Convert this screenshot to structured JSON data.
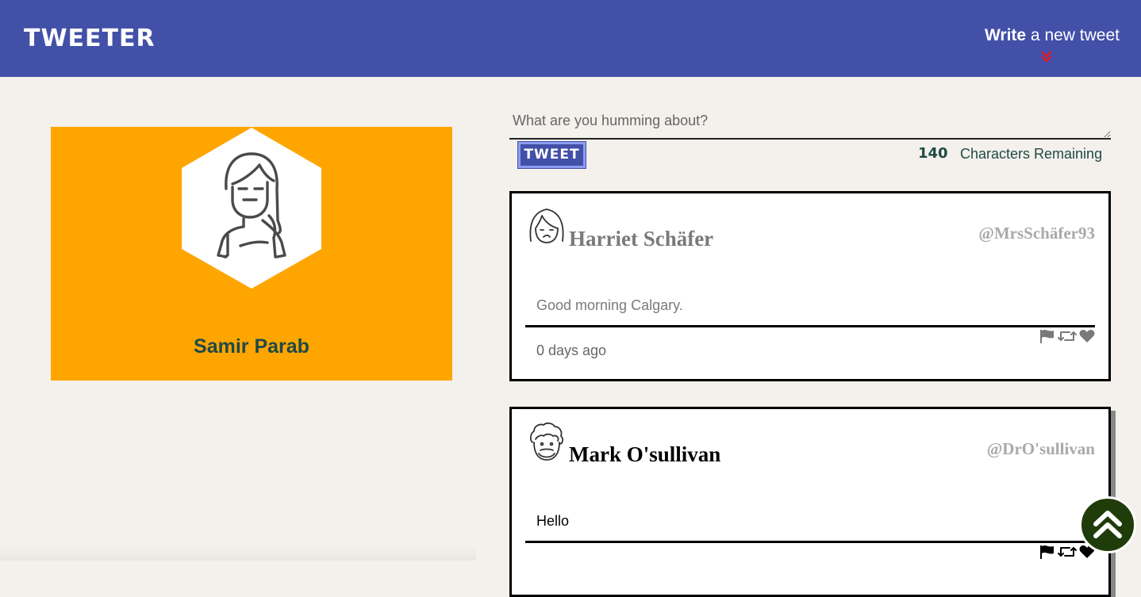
{
  "nav": {
    "logo": "TWEETER",
    "write_bold": "Write",
    "write_rest": " a new tweet",
    "chevron_color": "#e0192a"
  },
  "profile": {
    "name": "Samir Parab",
    "background_color": "#ffa500"
  },
  "composer": {
    "placeholder": "What are you humming about?",
    "value": "",
    "button_label": "TWEET",
    "counter": "140",
    "counter_label": "Characters Remaining"
  },
  "tweets": [
    {
      "name": "Harriet Schäfer",
      "handle": "@MrsSchäfer93",
      "text": "Good morning Calgary.",
      "date": "0 days ago",
      "actions": [
        "flag-icon",
        "retweet-icon",
        "heart-icon"
      ]
    },
    {
      "name": "Mark O'sullivan",
      "handle": "@DrO'sullivan",
      "text": "Hello",
      "date": "",
      "actions": [
        "flag-icon",
        "retweet-icon",
        "heart-icon"
      ]
    }
  ],
  "colors": {
    "nav": "#4250a8",
    "page_bg": "#f4f1ec",
    "accent_dark_teal": "#1f4a47",
    "scroll_button": "#1f3c0a"
  }
}
